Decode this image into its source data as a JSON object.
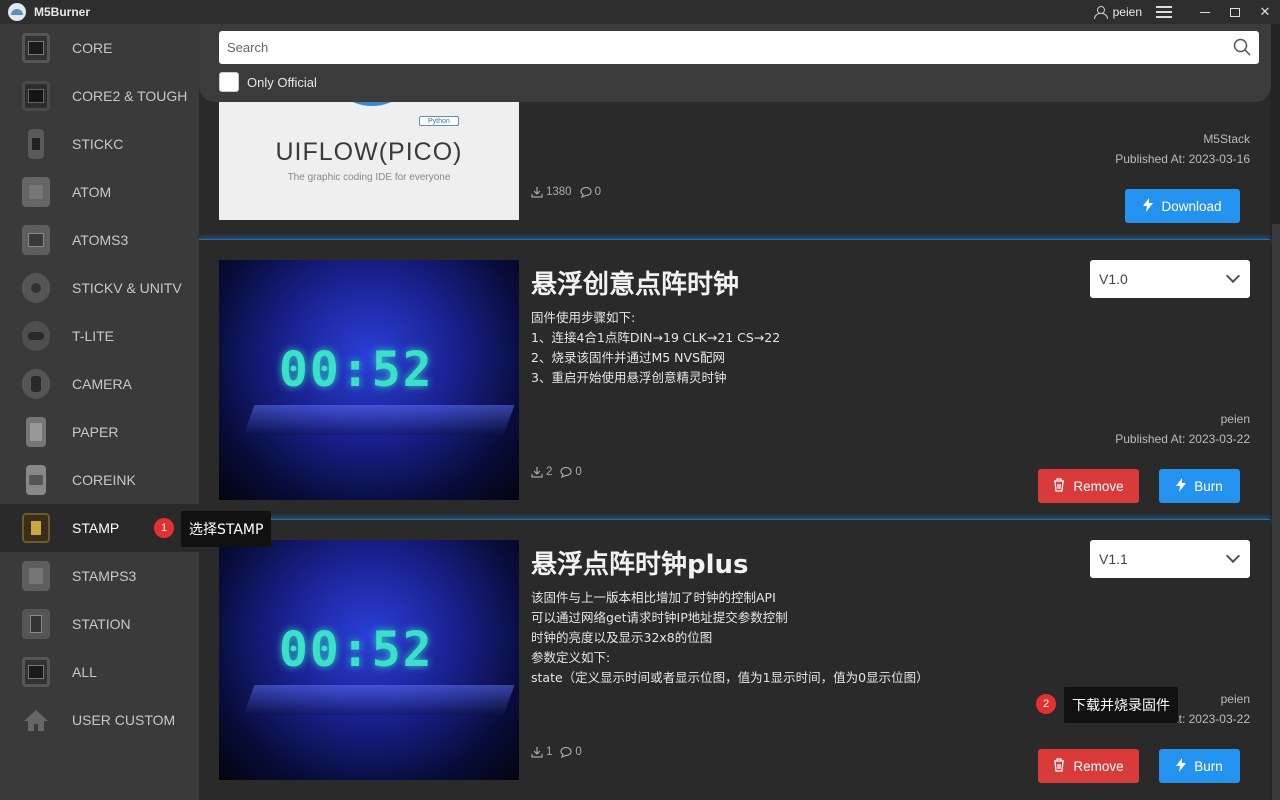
{
  "app": {
    "title": "M5Burner",
    "user": "peien"
  },
  "search": {
    "placeholder": "Search",
    "only_official_label": "Only Official"
  },
  "sidebar": {
    "items": [
      {
        "label": "CORE",
        "icon": "core-device-icon",
        "color": "#4a4a4a"
      },
      {
        "label": "CORE2 & TOUGH",
        "icon": "core2-device-icon",
        "color": "#4a4a4a"
      },
      {
        "label": "STICKC",
        "icon": "stickc-device-icon",
        "color": "#5a5a5a"
      },
      {
        "label": "ATOM",
        "icon": "atom-device-icon",
        "color": "#5e5e5e"
      },
      {
        "label": "ATOMS3",
        "icon": "atoms3-device-icon",
        "color": "#5e5e5e"
      },
      {
        "label": "STICKV & UNITV",
        "icon": "stickv-device-icon",
        "color": "#555"
      },
      {
        "label": "T-LITE",
        "icon": "tlite-device-icon",
        "color": "#555"
      },
      {
        "label": "CAMERA",
        "icon": "camera-device-icon",
        "color": "#555"
      },
      {
        "label": "PAPER",
        "icon": "paper-device-icon",
        "color": "#6a6a6a"
      },
      {
        "label": "COREINK",
        "icon": "coreink-device-icon",
        "color": "#6a6a6a"
      },
      {
        "label": "STAMP",
        "icon": "stamp-device-icon",
        "color": "#444"
      },
      {
        "label": "STAMPS3",
        "icon": "stamps3-device-icon",
        "color": "#5e5e5e"
      },
      {
        "label": "STATION",
        "icon": "station-device-icon",
        "color": "#555"
      },
      {
        "label": "ALL",
        "icon": "all-device-icon",
        "color": "#4a4a4a"
      },
      {
        "label": "USER CUSTOM",
        "icon": "home-icon",
        "color": "#555"
      }
    ]
  },
  "cards": [
    {
      "image_title": "UIFLOW(PICO)",
      "image_subtitle": "The graphic coding IDE for everyone",
      "image_tag": "Python",
      "author": "M5Stack",
      "published": "Published At: 2023-03-16",
      "downloads": "1380",
      "comments": "0",
      "action_label": "Download"
    },
    {
      "title": "悬浮创意点阵时钟",
      "version": "V1.0",
      "description": [
        "固件使用步骤如下:",
        "1、连接4合1点阵DIN→19 CLK→21 CS→22",
        "2、烧录该固件并通过M5 NVS配网",
        "3、重启开始使用悬浮创意精灵时钟"
      ],
      "author": "peien",
      "published": "Published At: 2023-03-22",
      "downloads": "2",
      "comments": "0",
      "remove_label": "Remove",
      "burn_label": "Burn",
      "led_text": "00:52"
    },
    {
      "title": "悬浮点阵时钟plus",
      "version": "V1.1",
      "description": [
        "该固件与上一版本相比增加了时钟的控制API",
        "可以通过网络get请求时钟IP地址提交参数控制",
        "时钟的亮度以及显示32x8的位图",
        "参数定义如下:",
        "state（定义显示时间或者显示位图，值为1显示时间，值为0显示位图）"
      ],
      "author": "peien",
      "published": "Published At: 2023-03-22",
      "downloads": "1",
      "comments": "0",
      "remove_label": "Remove",
      "burn_label": "Burn",
      "led_text": "00:52"
    }
  ],
  "annotations": {
    "step1_number": "1",
    "step1_text": "选择STAMP",
    "step2_number": "2",
    "step2_text": "下载并烧录固件"
  },
  "colors": {
    "accent": "#2493f0",
    "danger": "#d93a3a",
    "divider_glow": "#1a8cff"
  }
}
